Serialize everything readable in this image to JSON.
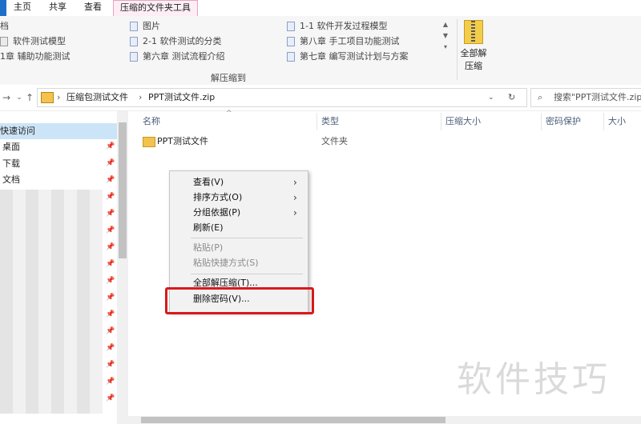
{
  "ribbon": {
    "tabs": [
      {
        "label": "主页"
      },
      {
        "label": "共享"
      },
      {
        "label": "查看"
      },
      {
        "label": "压缩的文件夹工具"
      }
    ],
    "extract_to": {
      "col1": [
        "档",
        "软件测试模型",
        "1章 辅助功能测试"
      ],
      "col2": [
        "图片",
        "2-1 软件测试的分类",
        "第六章 测试流程介绍"
      ],
      "col3": [
        "1-1 软件开发过程模型",
        "第八章 手工项目功能测试",
        "第七章 编写测试计划与方案"
      ],
      "group_label": "解压缩到"
    },
    "extract_all": {
      "line1": "全部解",
      "line2": "压缩"
    }
  },
  "address": {
    "crumbs": [
      "压缩包测试文件",
      "PPT测试文件.zip"
    ],
    "search_placeholder": "搜索\"PPT测试文件.zip\""
  },
  "nav": {
    "items": [
      {
        "label": "快速访问"
      },
      {
        "label": "桌面"
      },
      {
        "label": "下载"
      },
      {
        "label": "文档"
      }
    ]
  },
  "list": {
    "columns": [
      "名称",
      "类型",
      "压缩大小",
      "密码保护",
      "大小"
    ],
    "rows": [
      {
        "name": "PPT测试文件",
        "type": "文件夹"
      }
    ]
  },
  "context_menu": {
    "items": [
      {
        "label": "查看(V)",
        "submenu": true,
        "disabled": false
      },
      {
        "label": "排序方式(O)",
        "submenu": true,
        "disabled": false
      },
      {
        "label": "分组依据(P)",
        "submenu": true,
        "disabled": false
      },
      {
        "label": "刷新(E)",
        "submenu": false,
        "disabled": false
      },
      {
        "label": "粘贴(P)",
        "submenu": false,
        "disabled": true
      },
      {
        "label": "粘贴快捷方式(S)",
        "submenu": false,
        "disabled": true
      },
      {
        "label": "全部解压缩(T)...",
        "submenu": false,
        "disabled": false
      },
      {
        "label": "删除密码(V)...",
        "submenu": false,
        "disabled": false
      }
    ]
  },
  "watermark": "软件技巧",
  "colors": {
    "highlight": "#d8191c",
    "active_tab": "#fdeef5",
    "selection": "#cce4f7"
  }
}
